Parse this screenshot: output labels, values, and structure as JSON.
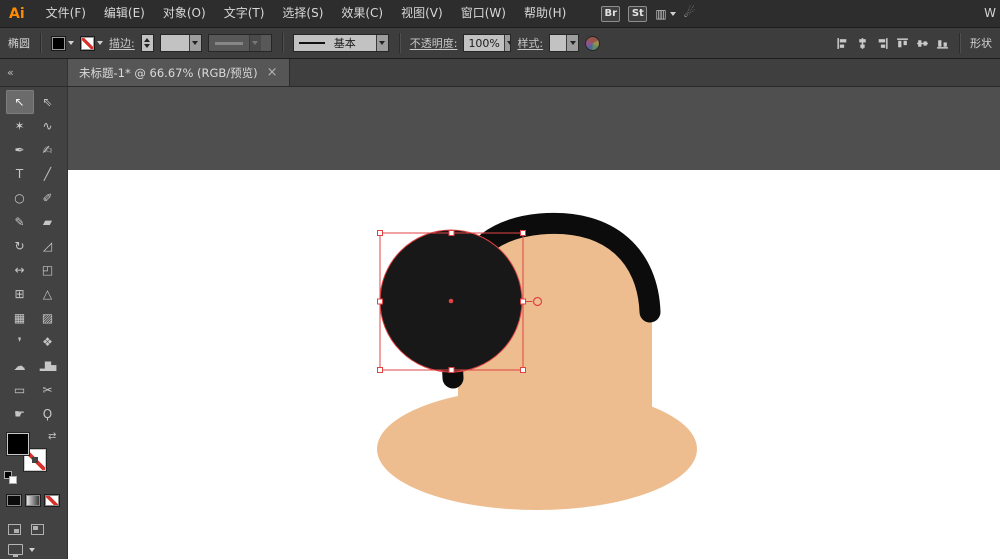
{
  "menu_bar": {
    "logo": "Ai",
    "items": [
      "文件(F)",
      "编辑(E)",
      "对象(O)",
      "文字(T)",
      "选择(S)",
      "效果(C)",
      "视图(V)",
      "窗口(W)",
      "帮助(H)"
    ],
    "br_badge": "Br",
    "st_badge": "St",
    "right_cutoff_label": "W"
  },
  "control_bar": {
    "object_label": "椭圆",
    "stroke_label": "描边:",
    "brush_value": "基本",
    "opacity_label": "不透明度:",
    "opacity_value": "100%",
    "style_label": "样式:",
    "shape_label": "形状"
  },
  "doc_tab": {
    "title": "未标题-1* @ 66.67% (RGB/预览)",
    "close_glyph": "×"
  },
  "toolbar": {
    "collapse_glyph": "«",
    "swap_glyph": "⇄",
    "tools": [
      {
        "name": "selection-tool",
        "glyph": "↖",
        "selected": true
      },
      {
        "name": "direct-selection-tool",
        "glyph": "⇖",
        "selected": false
      },
      {
        "name": "magic-wand-tool",
        "glyph": "✶",
        "selected": false
      },
      {
        "name": "lasso-tool",
        "glyph": "∿",
        "selected": false
      },
      {
        "name": "pen-tool",
        "glyph": "✒",
        "selected": false
      },
      {
        "name": "curvature-tool",
        "glyph": "✍",
        "selected": false
      },
      {
        "name": "type-tool",
        "glyph": "T",
        "selected": false
      },
      {
        "name": "line-segment-tool",
        "glyph": "╱",
        "selected": false
      },
      {
        "name": "ellipse-tool",
        "glyph": "○",
        "selected": false
      },
      {
        "name": "paintbrush-tool",
        "glyph": "✐",
        "selected": false
      },
      {
        "name": "pencil-tool",
        "glyph": "✎",
        "selected": false
      },
      {
        "name": "eraser-tool",
        "glyph": "▰",
        "selected": false
      },
      {
        "name": "rotate-tool",
        "glyph": "↻",
        "selected": false
      },
      {
        "name": "scale-tool",
        "glyph": "◿",
        "selected": false
      },
      {
        "name": "width-tool",
        "glyph": "↔",
        "selected": false
      },
      {
        "name": "free-transform-tool",
        "glyph": "◰",
        "selected": false
      },
      {
        "name": "shape-builder-tool",
        "glyph": "⊞",
        "selected": false
      },
      {
        "name": "perspective-grid-tool",
        "glyph": "△",
        "selected": false
      },
      {
        "name": "mesh-tool",
        "glyph": "▦",
        "selected": false
      },
      {
        "name": "gradient-tool",
        "glyph": "▨",
        "selected": false
      },
      {
        "name": "eyedropper-tool",
        "glyph": "❜",
        "selected": false
      },
      {
        "name": "blend-tool",
        "glyph": "❖",
        "selected": false
      },
      {
        "name": "symbol-sprayer-tool",
        "glyph": "☁",
        "selected": false
      },
      {
        "name": "column-graph-tool",
        "glyph": "▂█▅",
        "selected": false
      },
      {
        "name": "artboard-tool",
        "glyph": "▭",
        "selected": false
      },
      {
        "name": "slice-tool",
        "glyph": "✂",
        "selected": false
      },
      {
        "name": "hand-tool",
        "glyph": "☛",
        "selected": false
      },
      {
        "name": "zoom-tool",
        "glyph": "Ϙ",
        "selected": false
      }
    ]
  },
  "canvas": {
    "pasteboard_color": "#4f4f4f",
    "artboard_color": "#ffffff",
    "skin_color": "#edbd8f",
    "hair_color": "#0c0c0c",
    "circle_fill": "#181818",
    "selection_color": "#e04343",
    "handle_fill": "#ffffff"
  }
}
